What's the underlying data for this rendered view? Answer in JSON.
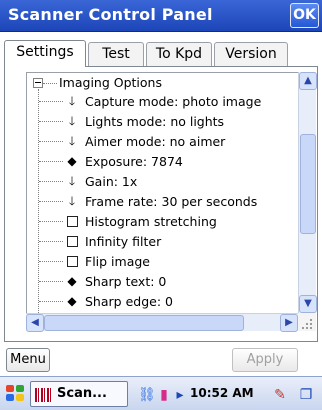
{
  "window": {
    "title": "Scanner Control Panel",
    "ok_label": "OK"
  },
  "tabs": [
    {
      "label": "Settings",
      "active": true
    },
    {
      "label": "Test",
      "active": false
    },
    {
      "label": "To Kpd",
      "active": false
    },
    {
      "label": "Version",
      "active": false
    }
  ],
  "tree": {
    "root": {
      "label": "Imaging Options",
      "expanded": true
    },
    "items": [
      {
        "icon": "arrow-down-icon",
        "glyph": "🡓",
        "label": "Capture mode: photo image"
      },
      {
        "icon": "arrow-down-icon",
        "glyph": "🡓",
        "label": "Lights mode: no lights"
      },
      {
        "icon": "arrow-down-icon",
        "glyph": "🡓",
        "label": "Aimer mode: no aimer"
      },
      {
        "icon": "diamond-icon",
        "glyph": "◆",
        "label": "Exposure: 7874"
      },
      {
        "icon": "arrow-down-icon",
        "glyph": "🡓",
        "label": "Gain: 1x"
      },
      {
        "icon": "arrow-down-icon",
        "glyph": "🡓",
        "label": "Frame rate: 30 per seconds"
      },
      {
        "icon": "checkbox-icon",
        "glyph": "",
        "label": "Histogram stretching"
      },
      {
        "icon": "checkbox-icon",
        "glyph": "",
        "label": "Infinity filter"
      },
      {
        "icon": "checkbox-icon",
        "glyph": "",
        "label": "Flip image"
      },
      {
        "icon": "diamond-icon",
        "glyph": "◆",
        "label": "Sharp text: 0"
      },
      {
        "icon": "diamond-icon",
        "glyph": "◆",
        "label": "Sharp edge: 0"
      }
    ]
  },
  "buttons": {
    "menu_label": "Menu",
    "apply_label": "Apply"
  },
  "taskbar": {
    "app_label": "Scan...",
    "clock": "10:52 AM",
    "tray_icons": [
      "network-icon",
      "battery-icon",
      "arrow-icon",
      "pen-icon",
      "windows-icon"
    ]
  },
  "colors": {
    "titlebar": "#2a58d0",
    "accent": "#1d47b8",
    "scrollbar": "#c9d8f8"
  }
}
